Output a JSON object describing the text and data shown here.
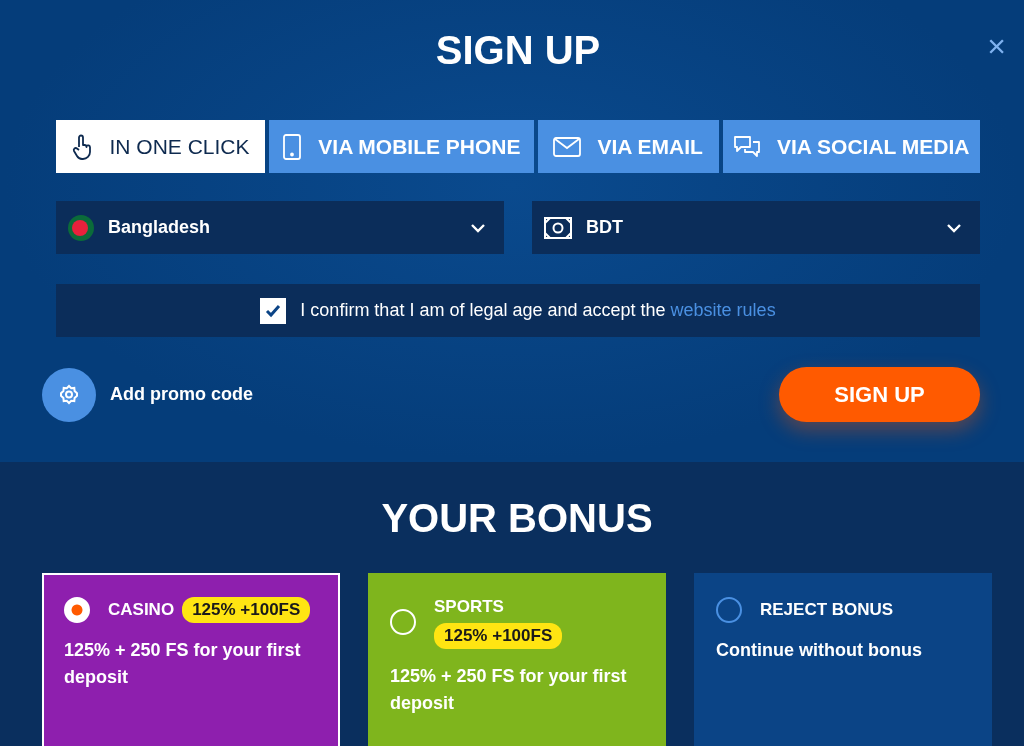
{
  "modal": {
    "title": "SIGN UP",
    "close": "×"
  },
  "tabs": [
    {
      "label": "IN ONE CLICK",
      "kind": "click",
      "selected": true
    },
    {
      "label": "VIA MOBILE PHONE",
      "kind": "phone",
      "selected": false
    },
    {
      "label": "VIA EMAIL",
      "kind": "email",
      "selected": false
    },
    {
      "label": "VIA SOCIAL MEDIA",
      "kind": "social",
      "selected": false
    }
  ],
  "country_select": {
    "value": "Bangladesh"
  },
  "currency_select": {
    "value": "BDT"
  },
  "legal_checkbox": {
    "checked": true,
    "label": "I confirm that I am of legal age and accept the",
    "link": "website rules"
  },
  "promo": {
    "label": "Add promo code"
  },
  "signup_button": "SIGN UP",
  "bonus": {
    "title": "YOUR BONUS",
    "options": [
      {
        "kind": "casino",
        "title": "CASINO",
        "badge": "125% +100FS",
        "description": "125% + 250 FS for your first deposit",
        "color": "#8e1fae",
        "selected": true
      },
      {
        "kind": "sports",
        "title": "SPORTS",
        "badge": "125% +100FS",
        "description": "125% + 250 FS for your first deposit",
        "color": "#7fb51d",
        "selected": false
      },
      {
        "kind": "reject",
        "title": "REJECT BONUS",
        "description": "Continue without bonus",
        "color": "#0b4486",
        "selected": false
      }
    ]
  }
}
